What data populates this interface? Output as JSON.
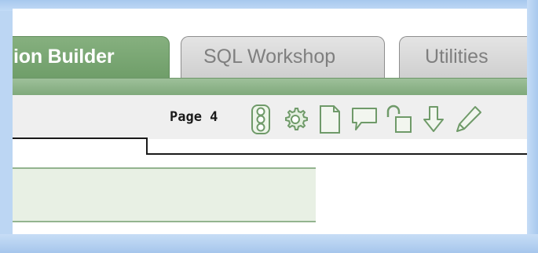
{
  "tabs": [
    {
      "label": "ion Builder",
      "state": "active"
    },
    {
      "label": "SQL Workshop",
      "state": "inactive"
    },
    {
      "label": "Utilities",
      "state": "inactive"
    }
  ],
  "toolbar": {
    "page_label": "Page 4",
    "icons": [
      "traffic-light-icon",
      "gear-icon",
      "new-page-icon",
      "comment-icon",
      "lock-icon",
      "export-arrow-icon",
      "edit-pencil-icon"
    ]
  },
  "colors": {
    "active_tab": "#7aa874",
    "inactive_tab": "#d9d9d9",
    "region_fill": "#e8f0e4",
    "background": "#bcd6f3"
  }
}
